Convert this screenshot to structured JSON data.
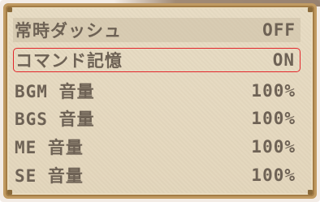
{
  "menu": {
    "items": [
      {
        "label": "常時ダッシュ",
        "value": "OFF"
      },
      {
        "label": "コマンド記憶",
        "value": "ON"
      },
      {
        "label": "BGM 音量",
        "value": "100%"
      },
      {
        "label": "BGS 音量",
        "value": "100%"
      },
      {
        "label": "ME 音量",
        "value": "100%"
      },
      {
        "label": "SE 音量",
        "value": "100%"
      }
    ],
    "selected_index": 1
  },
  "colors": {
    "text": "#6e6255",
    "selection_border": "#e3262a",
    "window_border": "#c09a62",
    "window_bg": "#e6d9c0"
  }
}
